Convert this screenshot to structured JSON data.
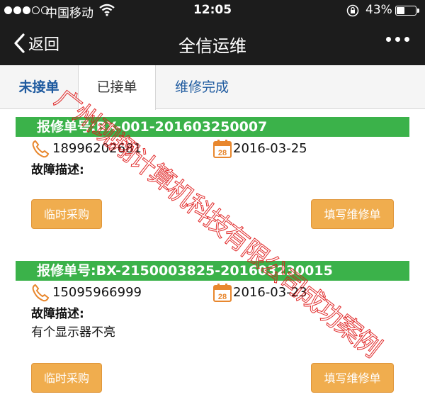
{
  "status_bar": {
    "carrier": "中国移动",
    "time": "12:05",
    "battery_percent_text": "43%",
    "battery_level": 0.43
  },
  "nav": {
    "back_label": "返回",
    "title": "全信运维"
  },
  "tabs": [
    {
      "label": "未接单"
    },
    {
      "label": "已接单"
    },
    {
      "label": "维修完成"
    }
  ],
  "active_tab": "已接单",
  "orders": [
    {
      "order_no": "报修单号:BX-001-201603250007",
      "phone": "18996202681",
      "date": "2016-03-25",
      "fault_label": "故障描述:",
      "fault_text": "",
      "btn_temp": "临时采购",
      "btn_fill": "填写维修单"
    },
    {
      "order_no": "报修单号:BX-2150003825-201603230015",
      "phone": "15095966999",
      "date": "2016-03-23",
      "fault_label": "故障描述:",
      "fault_text": "有个显示器不亮",
      "btn_temp": "临时采购",
      "btn_fill": "填写维修单"
    }
  ],
  "calendar_day": "28",
  "watermark": "广州现翔计算机科技有限公司成功案例",
  "colors": {
    "bar_bg": "#1c1c1c",
    "accent_green": "#3bb24a",
    "button_orange": "#f0ad4e",
    "tab_blue": "#1e5a9f",
    "watermark_red": "#de1818"
  }
}
